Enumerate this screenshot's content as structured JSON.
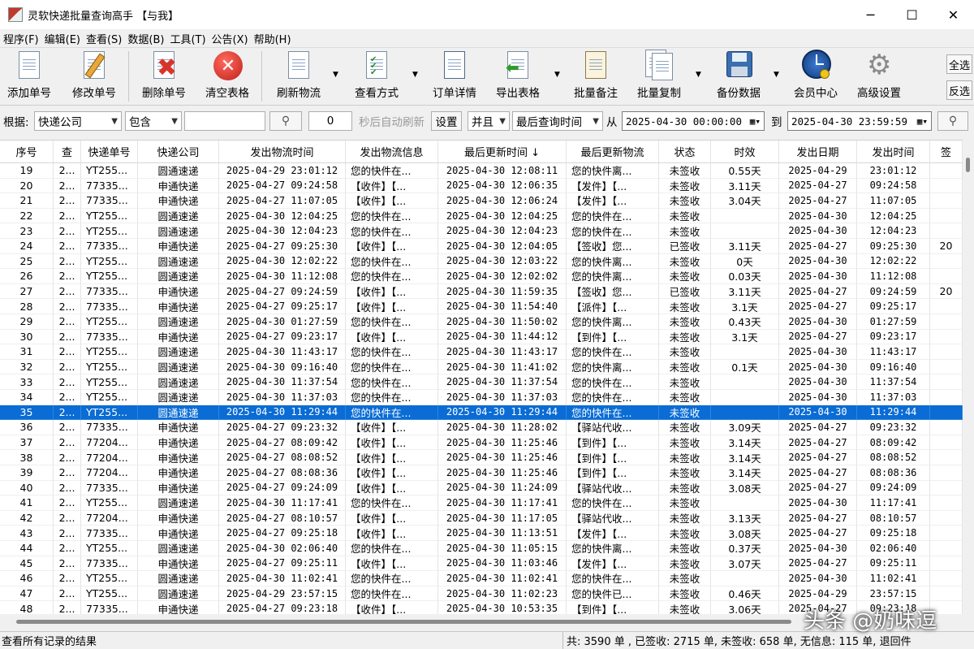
{
  "window": {
    "title": "灵软快递批量查询高手 【与我】",
    "minimize": "─",
    "maximize": "☐",
    "close": "✕"
  },
  "menu": [
    "程序(F)",
    "编辑(E)",
    "查看(S)",
    "数据(B)",
    "工具(T)",
    "公告(X)",
    "帮助(H)"
  ],
  "toolbar": {
    "add": "添加单号",
    "edit": "修改单号",
    "delete": "删除单号",
    "clear": "清空表格",
    "refresh": "刷新物流",
    "view_mode": "查看方式",
    "order_detail": "订单详情",
    "export": "导出表格",
    "batch_note": "批量备注",
    "batch_copy": "批量复制",
    "backup": "备份数据",
    "member": "会员中心",
    "advanced": "高级设置",
    "select_all": "全选",
    "invert": "反选"
  },
  "filter": {
    "by_label": "根据:",
    "field": "快递公司",
    "op": "包含",
    "keyword": "",
    "interval": "0",
    "auto_refresh": "秒后自动刷新",
    "settings": "设置",
    "logic": "并且",
    "time_field": "最后查询时间",
    "from_label": "从",
    "from": "2025-04-30 00:00:00",
    "to_label": "到",
    "to": "2025-04-30 23:59:59"
  },
  "columns": [
    "序号",
    "查",
    "快递单号",
    "快递公司",
    "发出物流时间",
    "发出物流信息",
    "最后更新时间 ↓",
    "最后更新物流",
    "状态",
    "时效",
    "发出日期",
    "发出时间",
    "签"
  ],
  "rows": [
    [
      "19",
      "2...",
      "YT255...",
      "圆通速递",
      "2025-04-29 23:01:12",
      "您的快件在...",
      "2025-04-30 12:08:11",
      "您的快件离...",
      "未签收",
      "0.55天",
      "2025-04-29",
      "23:01:12",
      ""
    ],
    [
      "20",
      "2...",
      "77335...",
      "申通快递",
      "2025-04-27 09:24:58",
      "【收件】【...",
      "2025-04-30 12:06:35",
      "【发件】【...",
      "未签收",
      "3.11天",
      "2025-04-27",
      "09:24:58",
      ""
    ],
    [
      "21",
      "2...",
      "77335...",
      "申通快递",
      "2025-04-27 11:07:05",
      "【收件】【...",
      "2025-04-30 12:06:24",
      "【发件】【...",
      "未签收",
      "3.04天",
      "2025-04-27",
      "11:07:05",
      ""
    ],
    [
      "22",
      "2...",
      "YT255...",
      "圆通速递",
      "2025-04-30 12:04:25",
      "您的快件在...",
      "2025-04-30 12:04:25",
      "您的快件在...",
      "未签收",
      "",
      "2025-04-30",
      "12:04:25",
      ""
    ],
    [
      "23",
      "2...",
      "YT255...",
      "圆通速递",
      "2025-04-30 12:04:23",
      "您的快件在...",
      "2025-04-30 12:04:23",
      "您的快件在...",
      "未签收",
      "",
      "2025-04-30",
      "12:04:23",
      ""
    ],
    [
      "24",
      "2...",
      "77335...",
      "申通快递",
      "2025-04-27 09:25:30",
      "【收件】【...",
      "2025-04-30 12:04:05",
      "【签收】您...",
      "已签收",
      "3.11天",
      "2025-04-27",
      "09:25:30",
      "20"
    ],
    [
      "25",
      "2...",
      "YT255...",
      "圆通速递",
      "2025-04-30 12:02:22",
      "您的快件在...",
      "2025-04-30 12:03:22",
      "您的快件离...",
      "未签收",
      "0天",
      "2025-04-30",
      "12:02:22",
      ""
    ],
    [
      "26",
      "2...",
      "YT255...",
      "圆通速递",
      "2025-04-30 11:12:08",
      "您的快件在...",
      "2025-04-30 12:02:02",
      "您的快件离...",
      "未签收",
      "0.03天",
      "2025-04-30",
      "11:12:08",
      ""
    ],
    [
      "27",
      "2...",
      "77335...",
      "申通快递",
      "2025-04-27 09:24:59",
      "【收件】【...",
      "2025-04-30 11:59:35",
      "【签收】您...",
      "已签收",
      "3.11天",
      "2025-04-27",
      "09:24:59",
      "20"
    ],
    [
      "28",
      "2...",
      "77335...",
      "申通快递",
      "2025-04-27 09:25:17",
      "【收件】【...",
      "2025-04-30 11:54:40",
      "【派件】【...",
      "未签收",
      "3.1天",
      "2025-04-27",
      "09:25:17",
      ""
    ],
    [
      "29",
      "2...",
      "YT255...",
      "圆通速递",
      "2025-04-30 01:27:59",
      "您的快件在...",
      "2025-04-30 11:50:02",
      "您的快件离...",
      "未签收",
      "0.43天",
      "2025-04-30",
      "01:27:59",
      ""
    ],
    [
      "30",
      "2...",
      "77335...",
      "申通快递",
      "2025-04-27 09:23:17",
      "【收件】【...",
      "2025-04-30 11:44:12",
      "【到件】【...",
      "未签收",
      "3.1天",
      "2025-04-27",
      "09:23:17",
      ""
    ],
    [
      "31",
      "2...",
      "YT255...",
      "圆通速递",
      "2025-04-30 11:43:17",
      "您的快件在...",
      "2025-04-30 11:43:17",
      "您的快件在...",
      "未签收",
      "",
      "2025-04-30",
      "11:43:17",
      ""
    ],
    [
      "32",
      "2...",
      "YT255...",
      "圆通速递",
      "2025-04-30 09:16:40",
      "您的快件在...",
      "2025-04-30 11:41:02",
      "您的快件离...",
      "未签收",
      "0.1天",
      "2025-04-30",
      "09:16:40",
      ""
    ],
    [
      "33",
      "2...",
      "YT255...",
      "圆通速递",
      "2025-04-30 11:37:54",
      "您的快件在...",
      "2025-04-30 11:37:54",
      "您的快件在...",
      "未签收",
      "",
      "2025-04-30",
      "11:37:54",
      ""
    ],
    [
      "34",
      "2...",
      "YT255...",
      "圆通速递",
      "2025-04-30 11:37:03",
      "您的快件在...",
      "2025-04-30 11:37:03",
      "您的快件在...",
      "未签收",
      "",
      "2025-04-30",
      "11:37:03",
      ""
    ],
    [
      "35",
      "2...",
      "YT255...",
      "圆通速递",
      "2025-04-30 11:29:44",
      "您的快件在...",
      "2025-04-30 11:29:44",
      "您的快件在...",
      "未签收",
      "",
      "2025-04-30",
      "11:29:44",
      ""
    ],
    [
      "36",
      "2...",
      "77335...",
      "申通快递",
      "2025-04-27 09:23:32",
      "【收件】【...",
      "2025-04-30 11:28:02",
      "【驿站代收...",
      "未签收",
      "3.09天",
      "2025-04-27",
      "09:23:32",
      ""
    ],
    [
      "37",
      "2...",
      "77204...",
      "申通快递",
      "2025-04-27 08:09:42",
      "【收件】【...",
      "2025-04-30 11:25:46",
      "【到件】【...",
      "未签收",
      "3.14天",
      "2025-04-27",
      "08:09:42",
      ""
    ],
    [
      "38",
      "2...",
      "77204...",
      "申通快递",
      "2025-04-27 08:08:52",
      "【收件】【...",
      "2025-04-30 11:25:46",
      "【到件】【...",
      "未签收",
      "3.14天",
      "2025-04-27",
      "08:08:52",
      ""
    ],
    [
      "39",
      "2...",
      "77204...",
      "申通快递",
      "2025-04-27 08:08:36",
      "【收件】【...",
      "2025-04-30 11:25:46",
      "【到件】【...",
      "未签收",
      "3.14天",
      "2025-04-27",
      "08:08:36",
      ""
    ],
    [
      "40",
      "2...",
      "77335...",
      "申通快递",
      "2025-04-27 09:24:09",
      "【收件】【...",
      "2025-04-30 11:24:09",
      "【驿站代收...",
      "未签收",
      "3.08天",
      "2025-04-27",
      "09:24:09",
      ""
    ],
    [
      "41",
      "2...",
      "YT255...",
      "圆通速递",
      "2025-04-30 11:17:41",
      "您的快件在...",
      "2025-04-30 11:17:41",
      "您的快件在...",
      "未签收",
      "",
      "2025-04-30",
      "11:17:41",
      ""
    ],
    [
      "42",
      "2...",
      "77204...",
      "申通快递",
      "2025-04-27 08:10:57",
      "【收件】【...",
      "2025-04-30 11:17:05",
      "【驿站代收...",
      "未签收",
      "3.13天",
      "2025-04-27",
      "08:10:57",
      ""
    ],
    [
      "43",
      "2...",
      "77335...",
      "申通快递",
      "2025-04-27 09:25:18",
      "【收件】【...",
      "2025-04-30 11:13:51",
      "【发件】【...",
      "未签收",
      "3.08天",
      "2025-04-27",
      "09:25:18",
      ""
    ],
    [
      "44",
      "2...",
      "YT255...",
      "圆通速递",
      "2025-04-30 02:06:40",
      "您的快件在...",
      "2025-04-30 11:05:15",
      "您的快件离...",
      "未签收",
      "0.37天",
      "2025-04-30",
      "02:06:40",
      ""
    ],
    [
      "45",
      "2...",
      "77335...",
      "申通快递",
      "2025-04-27 09:25:11",
      "【收件】【...",
      "2025-04-30 11:03:46",
      "【发件】【...",
      "未签收",
      "3.07天",
      "2025-04-27",
      "09:25:11",
      ""
    ],
    [
      "46",
      "2...",
      "YT255...",
      "圆通速递",
      "2025-04-30 11:02:41",
      "您的快件在...",
      "2025-04-30 11:02:41",
      "您的快件在...",
      "未签收",
      "",
      "2025-04-30",
      "11:02:41",
      ""
    ],
    [
      "47",
      "2...",
      "YT255...",
      "圆通速递",
      "2025-04-29 23:57:15",
      "您的快件在...",
      "2025-04-30 11:02:23",
      "您的快件已...",
      "未签收",
      "0.46天",
      "2025-04-29",
      "23:57:15",
      ""
    ],
    [
      "48",
      "2...",
      "77335...",
      "申通快递",
      "2025-04-27 09:23:18",
      "【收件】【...",
      "2025-04-30 10:53:35",
      "【到件】【...",
      "未签收",
      "3.06天",
      "2025-04-27",
      "09:23:18",
      ""
    ]
  ],
  "selected_row": "35",
  "status": {
    "left": "查看所有记录的结果",
    "right": "共: 3590 单 , 已签收:  2715 单, 未签收:  658 单, 无信息: 115 单, 退回件"
  },
  "watermark": "头条 @奶味逗",
  "colors": {
    "selection": "#0a6cd4",
    "delete_icon": "#d9342b",
    "title_bg": "#ffffff",
    "chrome_bg": "#f0f0f0"
  }
}
